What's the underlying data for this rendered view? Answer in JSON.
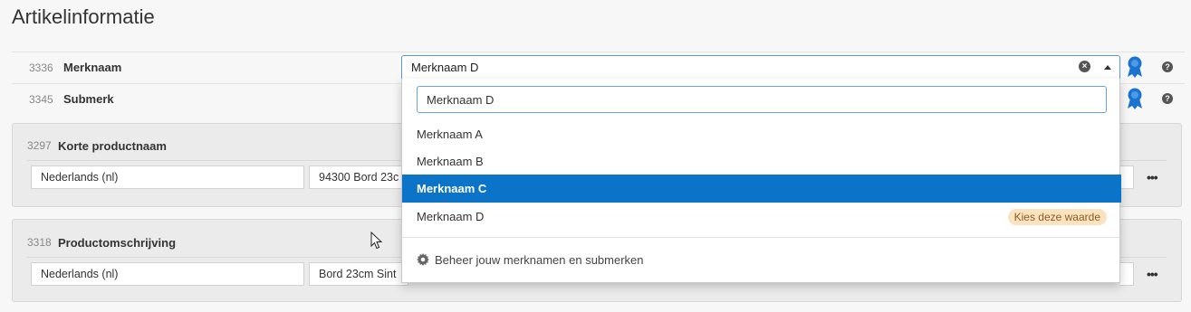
{
  "page": {
    "title": "Artikelinformatie"
  },
  "fields": {
    "brand": {
      "id": "3336",
      "label": "Merknaam",
      "value": "Merknaam D"
    },
    "subbrand": {
      "id": "3345",
      "label": "Submerk"
    }
  },
  "panels": {
    "short_name": {
      "id": "3297",
      "label": "Korte productnaam",
      "language": "Nederlands (nl)",
      "text": "94300 Bord 23c"
    },
    "description": {
      "id": "3318",
      "label": "Productomschrijving",
      "language": "Nederlands (nl)",
      "text": "Bord 23cm Sint"
    }
  },
  "dropdown": {
    "search_value": "Merknaam D",
    "options": [
      {
        "label": "Merknaam A"
      },
      {
        "label": "Merknaam B"
      },
      {
        "label": "Merknaam C",
        "selected": true
      },
      {
        "label": "Merknaam D",
        "badge": "Kies deze waarde"
      }
    ],
    "manage_label": "Beheer jouw merknamen en submerken"
  },
  "icons": {
    "ribbon": "award-ribbon-icon",
    "help": "question-circle-icon",
    "clear": "clear-circle-icon",
    "caret": "caret-up-icon",
    "more": "ellipsis-icon",
    "manage": "gear-icon"
  },
  "symbols": {
    "clear": "×",
    "help": "?",
    "more": "•••"
  },
  "colors": {
    "accent": "#0c74c8",
    "ribbon": "#1a73d1",
    "badge_bg": "#fce3c0",
    "badge_text": "#8a5b20"
  }
}
